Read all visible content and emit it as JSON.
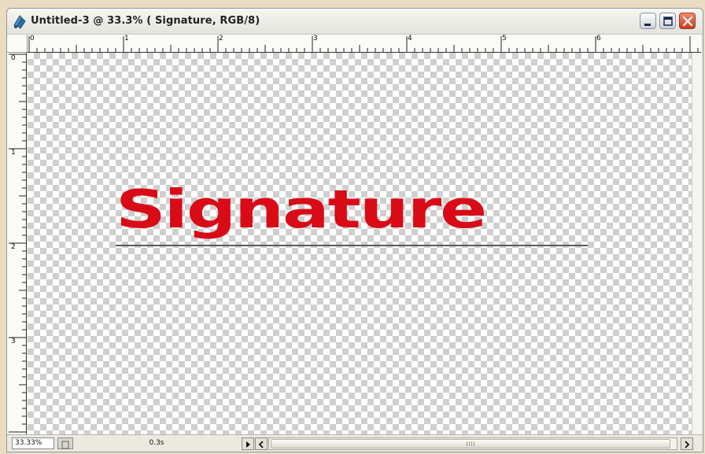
{
  "window": {
    "title": "Untitled-3 @ 33.3% ( Signature, RGB/8)",
    "icons": {
      "app": "photoshop-document-icon",
      "minimize": "minimize-icon",
      "maximize": "maximize-icon",
      "close": "close-icon"
    }
  },
  "rulers": {
    "top_labels": [
      "0",
      "1",
      "2",
      "3",
      "4",
      "5",
      "6"
    ],
    "left_labels": [
      "0",
      "1",
      "2",
      "3"
    ]
  },
  "canvas": {
    "text_layer": "Signature",
    "text_color": "#d90b16",
    "background": "transparency-checkerboard"
  },
  "statusbar": {
    "zoom": "33.33%",
    "info": "0.3s",
    "icons": {
      "menu_arrow": "play-right-icon",
      "scroll_left": "chevron-left-icon",
      "scroll_right": "chevron-right-icon"
    }
  }
}
